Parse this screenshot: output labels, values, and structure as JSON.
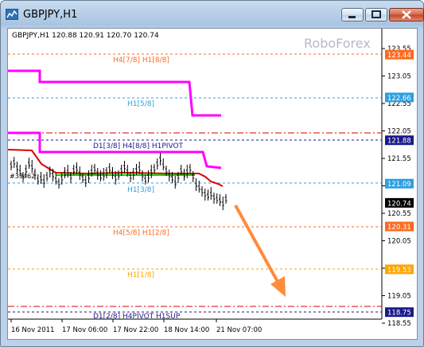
{
  "window": {
    "title": "GBPJPY,H1"
  },
  "chart": {
    "info": "GBPJPY,H1  120.88 120.91 120.70 120.74",
    "watermark": "RoboForex",
    "price_axis": [
      "123.55",
      "123.05",
      "122.55",
      "122.05",
      "121.55",
      "121.05",
      "120.55",
      "120.05",
      "119.55",
      "119.05",
      "118.55"
    ],
    "time_axis": [
      "16 Nov 2011",
      "17 Nov 06:00",
      "17 Nov 22:00",
      "18 Nov 14:00",
      "21 Nov 07:00"
    ],
    "price_tags": [
      {
        "value": "123.44",
        "color": "#ff6a20"
      },
      {
        "value": "122.66",
        "color": "#2f9fe0"
      },
      {
        "value": "121.88",
        "color": "#1a1a8c"
      },
      {
        "value": "121.09",
        "color": "#2f9fe0"
      },
      {
        "value": "120.74",
        "color": "#000000"
      },
      {
        "value": "120.31",
        "color": "#ff6a20"
      },
      {
        "value": "119.53",
        "color": "#ffa500"
      },
      {
        "value": "118.75",
        "color": "#1a1a8c"
      }
    ],
    "levels": {
      "h4_78": "H4[7/8] H1[8/8]",
      "h1_58": "H1[5/8]",
      "d1_38": "D1[3/8] H4[8/8] H1PIVOT",
      "h1_38": "H1[3/8]",
      "h4_58": "H4[5/8] H1[2/8]",
      "h1_18": "H1[1/8]",
      "d1_28": "D1[2/8] H4PIVOT H1SUP"
    },
    "marker": "#33462",
    "colors": {
      "magenta": "#ff00ff",
      "red": "#dd0000",
      "lime": "#00dd00",
      "orange_arrow": "#ff8c3a"
    }
  }
}
